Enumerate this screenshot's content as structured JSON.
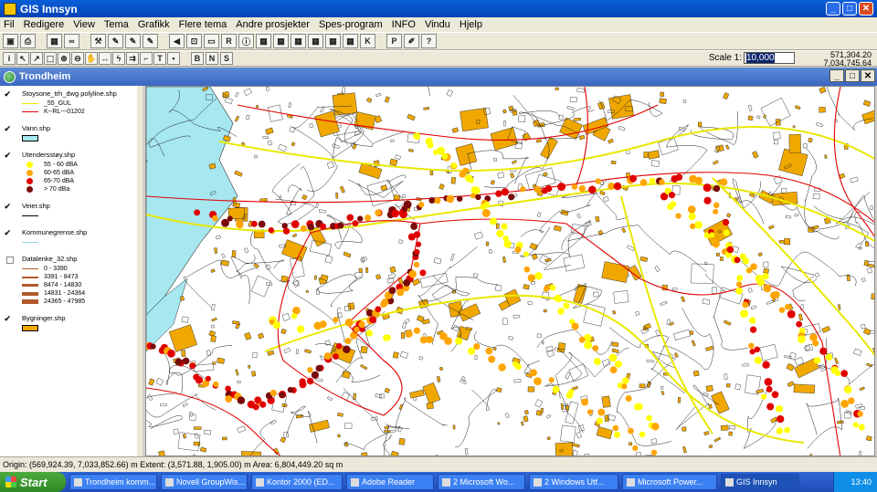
{
  "window": {
    "title": "GIS Innsyn"
  },
  "menu": [
    "Fil",
    "Redigere",
    "View",
    "Tema",
    "Grafikk",
    "Flere tema",
    "Andre prosjekter",
    "Spes-program",
    "INFO",
    "Vindu",
    "Hjelp"
  ],
  "toolbar2": {
    "text_buttons": [
      "B",
      "N",
      "S"
    ]
  },
  "scale": {
    "label": "Scale 1:",
    "value": "10,000"
  },
  "coordinates": {
    "x": "571,304.20",
    "y": "7,034,745.64"
  },
  "document": {
    "title": "Trondheim"
  },
  "legend": {
    "layers": [
      {
        "name": "Stoysone_trh_dwg polyline.shp",
        "checked": true,
        "items": [
          {
            "label": "_55_GUL",
            "color": "#e8e800",
            "kind": "line"
          },
          {
            "label": "K--RL---01202",
            "color": "#e00000",
            "kind": "line"
          }
        ]
      },
      {
        "name": "Vann.shp",
        "checked": true,
        "items": [
          {
            "label": "",
            "color": "#a6e7f0",
            "kind": "box"
          }
        ]
      },
      {
        "name": "Utendersstøy.shp",
        "checked": true,
        "items": [
          {
            "label": "55 - 60 dBA",
            "color": "#ffff00",
            "kind": "dot"
          },
          {
            "label": "60-65 dBA",
            "color": "#ffa500",
            "kind": "dot"
          },
          {
            "label": "65-70 dBA",
            "color": "#e00000",
            "kind": "dot"
          },
          {
            "label": "> 70 dBa",
            "color": "#7a0a0a",
            "kind": "dot"
          }
        ]
      },
      {
        "name": "Veier.shp",
        "checked": true,
        "items": [
          {
            "label": "",
            "color": "#000000",
            "kind": "line"
          }
        ]
      },
      {
        "name": "Kommunegrense.shp",
        "checked": true,
        "items": [
          {
            "label": "",
            "color": "#8ed8e8",
            "kind": "line"
          }
        ]
      },
      {
        "name": "Datalenke_32.shp",
        "checked": false,
        "items": [
          {
            "label": "0 - 3390",
            "color": "#b05a2a",
            "kind": "line"
          },
          {
            "label": "3391 - 8473",
            "color": "#b05a2a",
            "kind": "line"
          },
          {
            "label": "8474 - 14830",
            "color": "#b05a2a",
            "kind": "line"
          },
          {
            "label": "14831 - 24364",
            "color": "#b05a2a",
            "kind": "line"
          },
          {
            "label": "24365 - 47985",
            "color": "#b05a2a",
            "kind": "line"
          }
        ]
      },
      {
        "name": "Bygninger.shp",
        "checked": true,
        "items": [
          {
            "label": "",
            "color": "#f0a800",
            "kind": "box"
          }
        ]
      }
    ]
  },
  "statusbar": {
    "text": "Origin: (569,924.39, 7,033,852.66) m  Extent: (3,571.88, 1,905.00) m  Area: 6,804,449.20 sq m"
  },
  "taskbar": {
    "start": "Start",
    "tasks": [
      "Trondheim komm...",
      "Novell GroupWis...",
      "Kontor 2000 (ED...",
      "Adobe Reader",
      "2 Microsoft Wo...",
      "2 Windows Utf...",
      "Microsoft Power...",
      "GIS Innsyn"
    ],
    "active_task": "GIS Innsyn",
    "clock": "13:40"
  },
  "colors": {
    "building": "#f0a800",
    "road_red": "#e00000",
    "water": "#a6e7f0",
    "noise_55": "#ffff00",
    "noise_60": "#ffa500",
    "noise_65": "#e00000",
    "noise_70": "#7a0a0a"
  }
}
